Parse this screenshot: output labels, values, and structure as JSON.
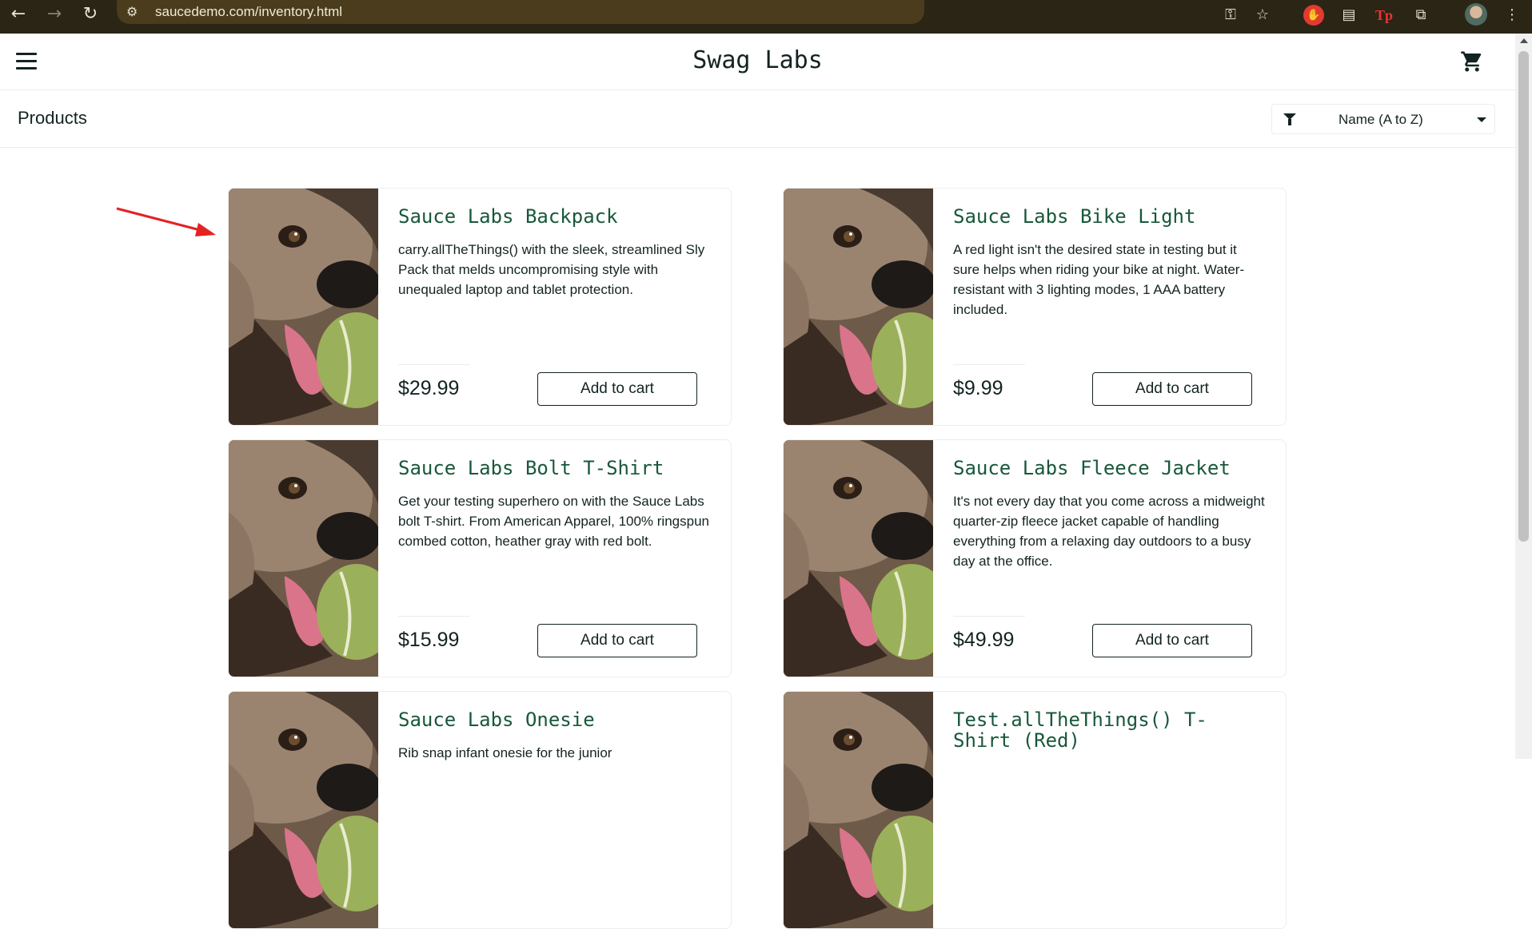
{
  "browser": {
    "url": "saucedemo.com/inventory.html",
    "icons": [
      "back-icon",
      "forward-icon",
      "reload-icon",
      "site-settings-icon",
      "password-key-icon",
      "bookmark-star-icon",
      "extension-hand-icon",
      "reader-mode-icon",
      "tp-extension-icon",
      "extensions-puzzle-icon",
      "profile-avatar",
      "more-options-icon"
    ]
  },
  "header": {
    "logo": "Swag Labs",
    "menu_icon": "hamburger-menu-icon",
    "cart_icon": "shopping-cart-icon"
  },
  "subheader": {
    "title": "Products",
    "sort_value": "Name (A to Z)",
    "sort_icon": "filter-funnel-icon"
  },
  "products": [
    {
      "name": "Sauce Labs Backpack",
      "description": "carry.allTheThings() with the sleek, streamlined Sly Pack that melds uncompromising style with unequaled laptop and tablet protection.",
      "price": "$29.99",
      "button": "Add to cart"
    },
    {
      "name": "Sauce Labs Bike Light",
      "description": "A red light isn't the desired state in testing but it sure helps when riding your bike at night. Water-resistant with 3 lighting modes, 1 AAA battery included.",
      "price": "$9.99",
      "button": "Add to cart"
    },
    {
      "name": "Sauce Labs Bolt T-Shirt",
      "description": "Get your testing superhero on with the Sauce Labs bolt T-shirt. From American Apparel, 100% ringspun combed cotton, heather gray with red bolt.",
      "price": "$15.99",
      "button": "Add to cart"
    },
    {
      "name": "Sauce Labs Fleece Jacket",
      "description": "It's not every day that you come across a midweight quarter-zip fleece jacket capable of handling everything from a relaxing day outdoors to a busy day at the office.",
      "price": "$49.99",
      "button": "Add to cart"
    },
    {
      "name": "Sauce Labs Onesie",
      "description": "Rib snap infant onesie for the junior",
      "price": "",
      "button": ""
    },
    {
      "name": "Test.allTheThings() T-Shirt (Red)",
      "description": "",
      "price": "",
      "button": ""
    }
  ],
  "colors": {
    "accent_title": "#18583a",
    "text": "#132322",
    "annotation": "#e32222"
  }
}
